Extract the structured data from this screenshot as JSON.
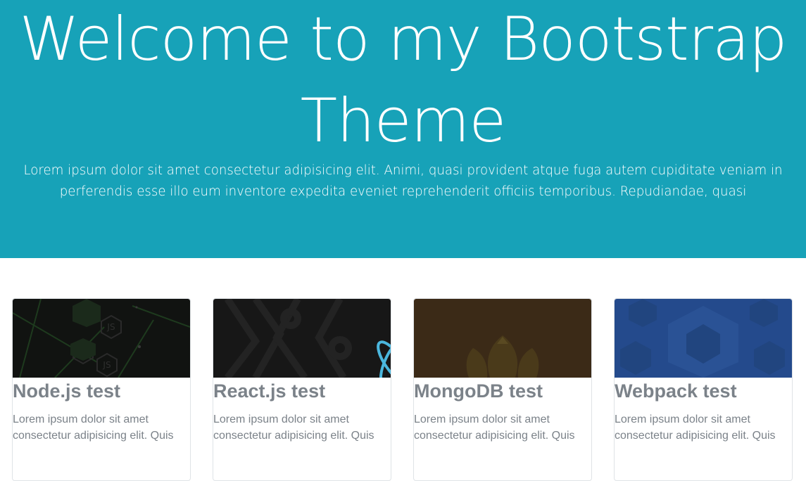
{
  "hero": {
    "title": "Welcome to my Bootstrap Theme",
    "lead": "Lorem ipsum dolor sit amet consectetur adipisicing elit. Animi, quasi provident atque fuga autem cupiditate veniam in perferendis esse illo eum inventore expedita eveniet reprehenderit officiis temporibus. Repudiandae, quasi",
    "background": "#17a2b8"
  },
  "cards": [
    {
      "title": "Node.js test",
      "text": "Lorem ipsum dolor sit amet consectetur adipisicing elit. Quis",
      "image_icon": "nodejs-logo-icon",
      "image_color": "#111311"
    },
    {
      "title": "React.js test",
      "text": "Lorem ipsum dolor sit amet consectetur adipisicing elit. Quis",
      "image_icon": "react-logo-icon",
      "image_color": "#171717"
    },
    {
      "title": "MongoDB test",
      "text": "Lorem ipsum dolor sit amet consectetur adipisicing elit. Quis",
      "image_icon": "mongodb-leaf-icon",
      "image_color": "#3b2a17"
    },
    {
      "title": "Webpack test",
      "text": "Lorem ipsum dolor sit amet consectetur adipisicing elit. Quis",
      "image_icon": "webpack-cube-icon",
      "image_color": "#244a8c"
    }
  ]
}
